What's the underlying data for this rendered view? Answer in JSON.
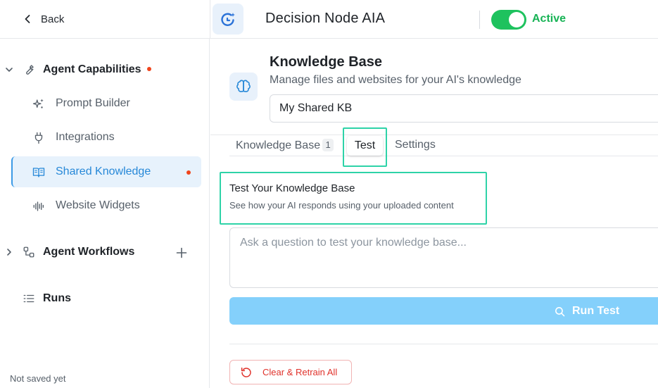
{
  "header": {
    "back_label": "Back",
    "app_title": "Decision Node AIA",
    "toggle_on": true,
    "status_label": "Active",
    "colors": {
      "active": "#1ec25e",
      "accent": "#2688d8"
    }
  },
  "sidebar": {
    "sections": [
      {
        "label": "Agent Capabilities",
        "icon": "wrench-icon",
        "expanded": true,
        "has_unsaved_dot": true,
        "items": [
          {
            "label": "Prompt Builder",
            "icon": "sparkles-icon",
            "active": false
          },
          {
            "label": "Integrations",
            "icon": "plug-icon",
            "active": false
          },
          {
            "label": "Shared Knowledge",
            "icon": "book-open-icon",
            "active": true,
            "has_unsaved_dot": true
          },
          {
            "label": "Website Widgets",
            "icon": "audio-wave-icon",
            "active": false
          }
        ]
      },
      {
        "label": "Agent Workflows",
        "icon": "workflow-icon",
        "expanded": false,
        "add_button": true
      },
      {
        "label": "Runs",
        "icon": "list-icon"
      }
    ],
    "footer_status": "Not saved yet"
  },
  "main": {
    "knowledge_base": {
      "icon": "brain-icon",
      "title": "Knowledge Base",
      "subtitle": "Manage files and websites for your AI's knowledge",
      "selected_kb": "My Shared KB"
    },
    "tabs": [
      {
        "label": "Knowledge Base",
        "count": "1",
        "active": false
      },
      {
        "label": "Test",
        "active": true
      },
      {
        "label": "Settings",
        "active": false
      }
    ],
    "test_panel": {
      "title": "Test Your Knowledge Base",
      "subtitle": "See how your AI responds using your uploaded content",
      "question_value": "",
      "question_placeholder": "Ask a question to test your knowledge base...",
      "run_button_label": "Run Test",
      "run_button_icon": "search-icon"
    },
    "retrain_button_label": "Clear & Retrain All",
    "retrain_button_icon": "refresh-icon"
  }
}
